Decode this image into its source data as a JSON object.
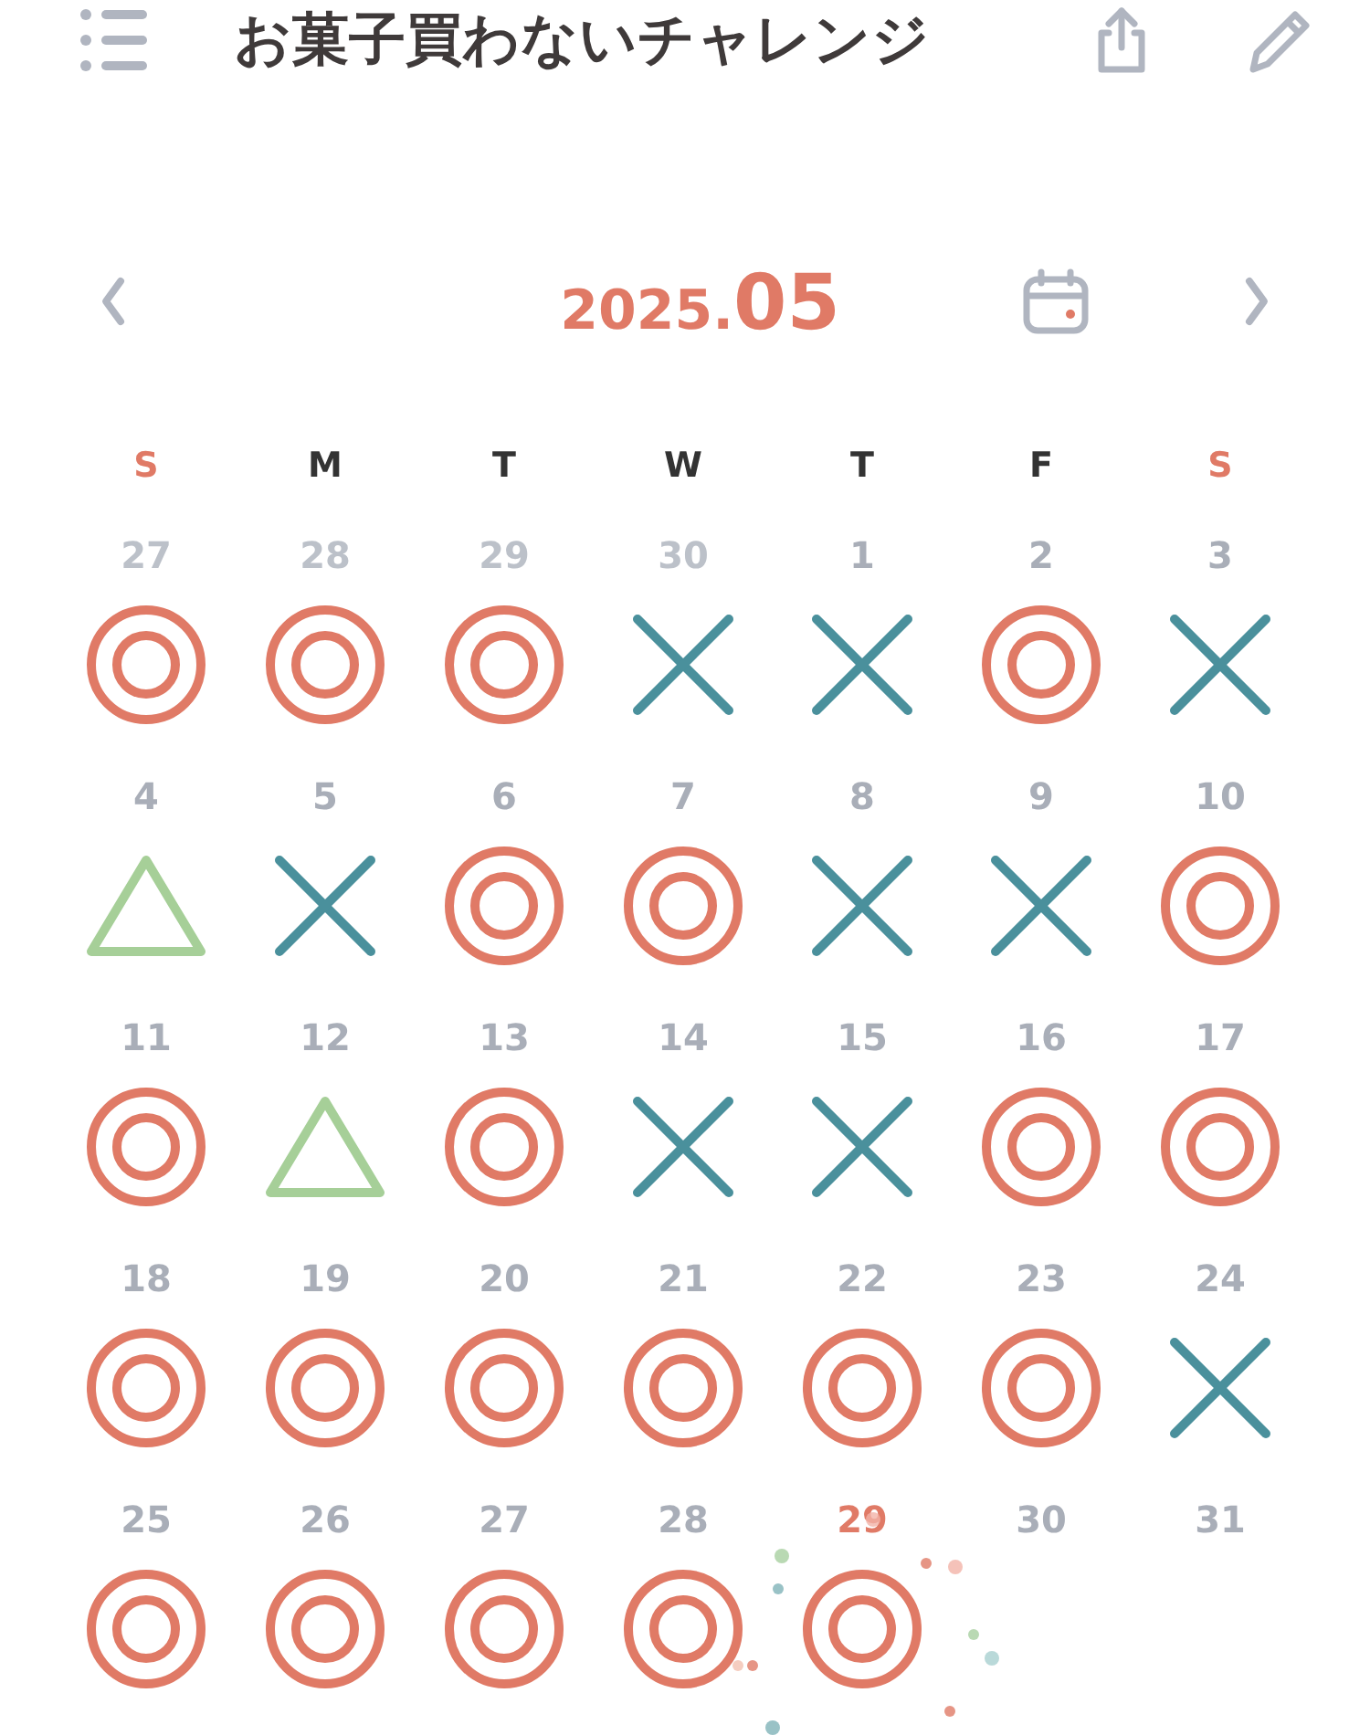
{
  "header": {
    "title": "お菓子買わないチャレンジ"
  },
  "month_nav": {
    "year": "2025.",
    "month": "05"
  },
  "weekdays": [
    {
      "label": "S",
      "weekend": true
    },
    {
      "label": "M",
      "weekend": false
    },
    {
      "label": "T",
      "weekend": false
    },
    {
      "label": "W",
      "weekend": false
    },
    {
      "label": "T",
      "weekend": false
    },
    {
      "label": "F",
      "weekend": false
    },
    {
      "label": "S",
      "weekend": true
    }
  ],
  "days": [
    {
      "day": "27",
      "outside": true,
      "today": false,
      "kind": "double_circle"
    },
    {
      "day": "28",
      "outside": true,
      "today": false,
      "kind": "double_circle"
    },
    {
      "day": "29",
      "outside": true,
      "today": false,
      "kind": "double_circle"
    },
    {
      "day": "30",
      "outside": true,
      "today": false,
      "kind": "cross"
    },
    {
      "day": "1",
      "outside": false,
      "today": false,
      "kind": "cross"
    },
    {
      "day": "2",
      "outside": false,
      "today": false,
      "kind": "double_circle"
    },
    {
      "day": "3",
      "outside": false,
      "today": false,
      "kind": "cross"
    },
    {
      "day": "4",
      "outside": false,
      "today": false,
      "kind": "triangle"
    },
    {
      "day": "5",
      "outside": false,
      "today": false,
      "kind": "cross"
    },
    {
      "day": "6",
      "outside": false,
      "today": false,
      "kind": "double_circle"
    },
    {
      "day": "7",
      "outside": false,
      "today": false,
      "kind": "double_circle"
    },
    {
      "day": "8",
      "outside": false,
      "today": false,
      "kind": "cross"
    },
    {
      "day": "9",
      "outside": false,
      "today": false,
      "kind": "cross"
    },
    {
      "day": "10",
      "outside": false,
      "today": false,
      "kind": "double_circle"
    },
    {
      "day": "11",
      "outside": false,
      "today": false,
      "kind": "double_circle"
    },
    {
      "day": "12",
      "outside": false,
      "today": false,
      "kind": "triangle"
    },
    {
      "day": "13",
      "outside": false,
      "today": false,
      "kind": "double_circle"
    },
    {
      "day": "14",
      "outside": false,
      "today": false,
      "kind": "cross"
    },
    {
      "day": "15",
      "outside": false,
      "today": false,
      "kind": "cross"
    },
    {
      "day": "16",
      "outside": false,
      "today": false,
      "kind": "double_circle"
    },
    {
      "day": "17",
      "outside": false,
      "today": false,
      "kind": "double_circle"
    },
    {
      "day": "18",
      "outside": false,
      "today": false,
      "kind": "double_circle"
    },
    {
      "day": "19",
      "outside": false,
      "today": false,
      "kind": "double_circle"
    },
    {
      "day": "20",
      "outside": false,
      "today": false,
      "kind": "double_circle"
    },
    {
      "day": "21",
      "outside": false,
      "today": false,
      "kind": "double_circle"
    },
    {
      "day": "22",
      "outside": false,
      "today": false,
      "kind": "double_circle"
    },
    {
      "day": "23",
      "outside": false,
      "today": false,
      "kind": "double_circle"
    },
    {
      "day": "24",
      "outside": false,
      "today": false,
      "kind": "cross"
    },
    {
      "day": "25",
      "outside": false,
      "today": false,
      "kind": "double_circle"
    },
    {
      "day": "26",
      "outside": false,
      "today": false,
      "kind": "double_circle"
    },
    {
      "day": "27",
      "outside": false,
      "today": false,
      "kind": "double_circle"
    },
    {
      "day": "28",
      "outside": false,
      "today": false,
      "kind": "double_circle"
    },
    {
      "day": "29",
      "outside": false,
      "today": true,
      "kind": "double_circle"
    },
    {
      "day": "30",
      "outside": false,
      "today": false,
      "kind": "none"
    },
    {
      "day": "31",
      "outside": false,
      "today": false,
      "kind": "none"
    }
  ]
}
